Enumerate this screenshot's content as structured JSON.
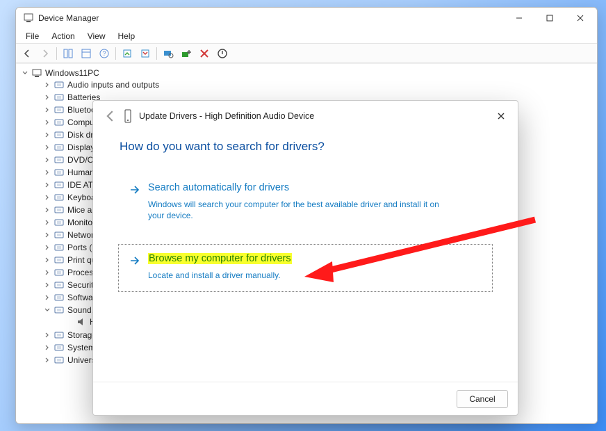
{
  "window": {
    "title": "Device Manager",
    "menus": [
      "File",
      "Action",
      "View",
      "Help"
    ]
  },
  "tree": {
    "root": "Windows11PC",
    "nodes": [
      "Audio inputs and outputs",
      "Batteries",
      "Bluetooth",
      "Computer",
      "Disk drives",
      "Display adapters",
      "DVD/CD-ROM drives",
      "Human Interface Devices",
      "IDE ATA/ATAPI controllers",
      "Keyboards",
      "Mice and other pointing devices",
      "Monitors",
      "Network adapters",
      "Ports (COM & LPT)",
      "Print queues",
      "Processors",
      "Security devices",
      "Software devices"
    ],
    "sound_node": "Sound, video and game controllers",
    "sound_child": "High Definition Audio Device",
    "tail_nodes": [
      "Storage controllers",
      "System devices",
      "Universal Serial Bus controllers"
    ]
  },
  "dialog": {
    "title": "Update Drivers - High Definition Audio Device",
    "heading": "How do you want to search for drivers?",
    "opt1": {
      "title": "Search automatically for drivers",
      "desc": "Windows will search your computer for the best available driver and install it on your device."
    },
    "opt2": {
      "title": "Browse my computer for drivers",
      "desc": "Locate and install a driver manually."
    },
    "cancel": "Cancel"
  }
}
